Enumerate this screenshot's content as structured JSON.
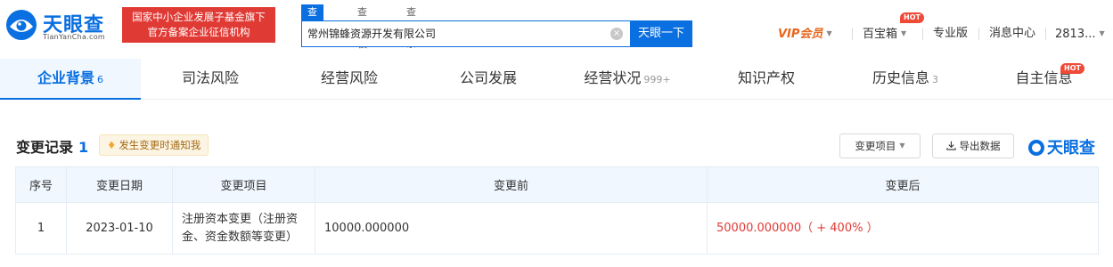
{
  "logo": {
    "name": "天眼查",
    "domain": "TianYanCha.com"
  },
  "slogan": {
    "line1": "国家中小企业发展子基金旗下",
    "line2": "官方备案企业征信机构"
  },
  "search": {
    "tabs": [
      "查公司",
      "查老板",
      "查关系"
    ],
    "value": "常州锦蜂资源开发有限公司",
    "clear_icon": "×",
    "button": "天眼一下"
  },
  "topnav": {
    "vip": "VIP会员",
    "treasure": "百宝箱",
    "hot": "HOT",
    "pro": "专业版",
    "messages": "消息中心",
    "user": "2813..."
  },
  "tabs": [
    {
      "label": "企业背景",
      "count": "6"
    },
    {
      "label": "司法风险",
      "count": ""
    },
    {
      "label": "经营风险",
      "count": ""
    },
    {
      "label": "公司发展",
      "count": ""
    },
    {
      "label": "经营状况",
      "count": "999+"
    },
    {
      "label": "知识产权",
      "count": ""
    },
    {
      "label": "历史信息",
      "count": "3"
    },
    {
      "label": "自主信息",
      "count": ""
    }
  ],
  "tab_hot": "HOT",
  "section": {
    "title": "变更记录",
    "count": "1",
    "notify": "发生变更时通知我",
    "filter_button": "变更项目",
    "export_button": "导出数据",
    "brand": "天眼查"
  },
  "table": {
    "headers": [
      "序号",
      "变更日期",
      "变更项目",
      "变更前",
      "变更后"
    ],
    "rows": [
      {
        "no": "1",
        "date": "2023-01-10",
        "item": "注册资本变更（注册资金、资金数额等变更）",
        "before": "10000.000000",
        "after": "50000.000000（ + 400% ）"
      }
    ]
  },
  "colors": {
    "brand": "#0a6fe0",
    "red": "#e03a35",
    "vip": "#e8661c"
  }
}
